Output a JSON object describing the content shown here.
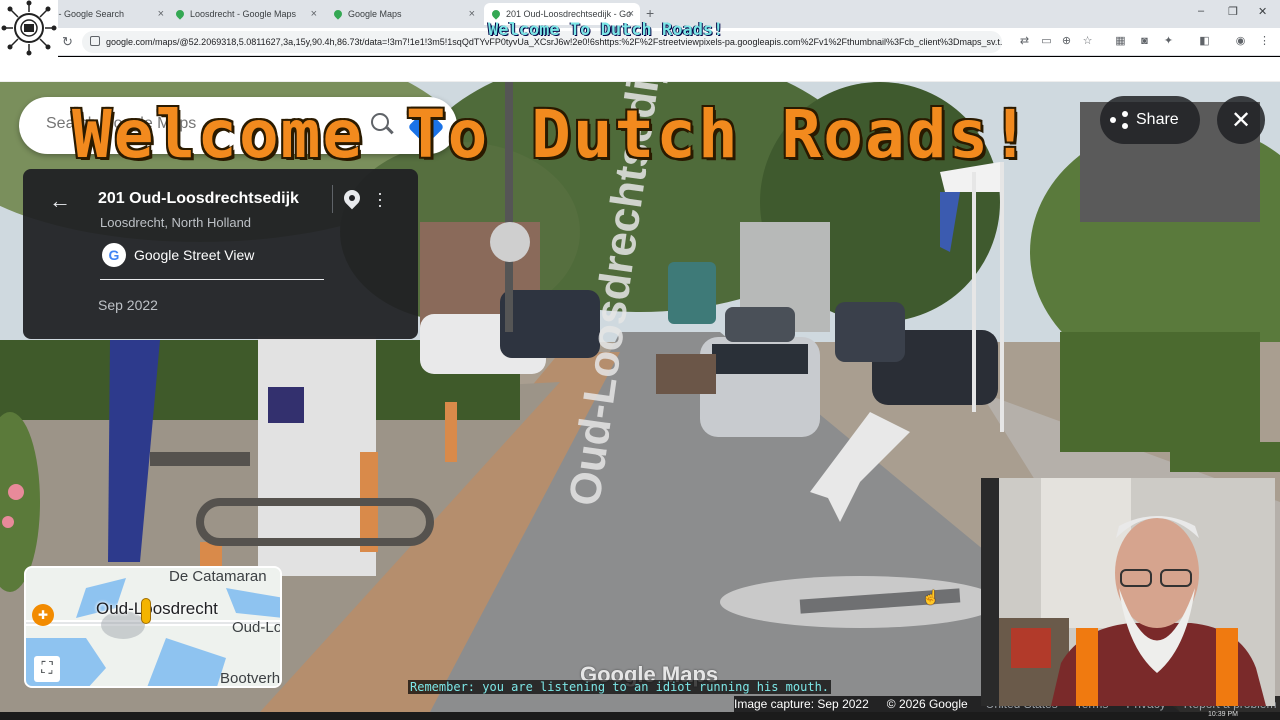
{
  "tabs": [
    {
      "label": "cht - Google Search",
      "icon": "google-icon"
    },
    {
      "label": "Loosdrecht - Google Maps",
      "icon": "maps-pin-icon"
    },
    {
      "label": "Google Maps",
      "icon": "maps-pin-icon"
    },
    {
      "label": "201 Oud-Loosdrechtsedijk - Go",
      "icon": "maps-pin-icon"
    }
  ],
  "tab_close": "×",
  "new_tab": "+",
  "window": {
    "minimize": "–",
    "restore": "❐",
    "close": "✕"
  },
  "address": {
    "url": "google.com/maps/@52.2069318,5.0811627,3a,15y,90.4h,86.73t/data=!3m7!1e1!3m5!1sqQdTYvFP0tyvUa_XCsrJ6w!2e0!6shttps:%2F%2Fstreetviewpixels-pa.googleapis.com%2Fv1%2Fthumbnail%3Fcb_client%3Dmaps_sv.t..."
  },
  "overlay": {
    "caption_top": "Welcome To Dutch Roads!",
    "welcome": "Welcome To Dutch Roads!",
    "caption_bottom": "Remember: you are listening to an idiot running his mouth."
  },
  "search": {
    "placeholder": "Search Google Maps"
  },
  "card": {
    "title": "201 Oud-Loosdrechtsedijk",
    "subtitle": "Loosdrecht, North Holland",
    "source": "Google Street View",
    "date": "Sep 2022"
  },
  "share_label": "Share",
  "close_label": "✕",
  "minimap": {
    "labels": {
      "top": "De Catamaran",
      "main": "Oud-Loosdrecht",
      "right": "Oud-Lo",
      "bottom": "Bootverh"
    }
  },
  "road_text": "Oud-Loosdrechtsedijk",
  "watermark": "Google Maps",
  "footer": {
    "capture": "Image capture: Sep 2022",
    "copyright": "© 2026 Google",
    "country": "United States",
    "terms": "Terms",
    "privacy": "Privacy",
    "report": "Report a problem"
  },
  "taskbar": {
    "clock": "10:39 PM"
  },
  "colors": {
    "accent_orange": "#f28a1e",
    "caption_cyan": "#7ce6e6",
    "maps_blue": "#1a73e8"
  }
}
